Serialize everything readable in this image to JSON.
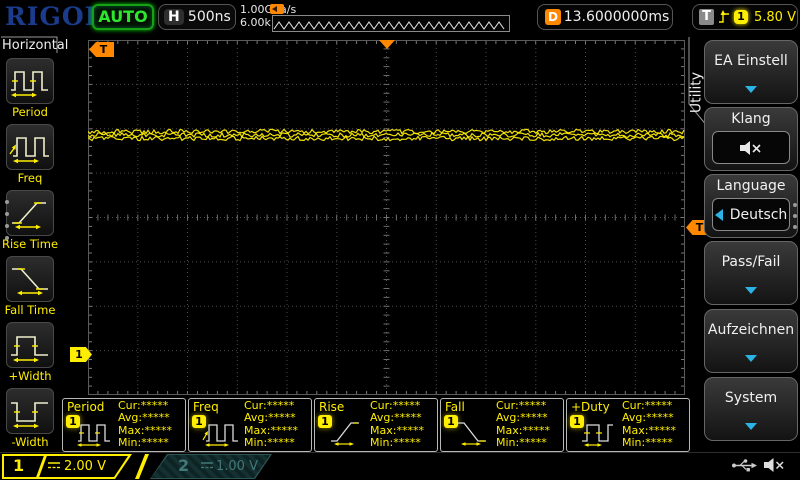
{
  "colors": {
    "trace_yellow": "#ffee00",
    "orange": "#ff8800",
    "menu_blue": "#2bb3e6",
    "run_green": "#2ee62e",
    "logo_blue": "#1b3c8c",
    "ch2_teal": "#437878",
    "grid_gray": "#4c4c4c"
  },
  "top_bar": {
    "logo": "RIGOL",
    "run_status": "AUTO",
    "horizontal_label": "H",
    "timebase": "500ns",
    "sample_rate": "1.00GSa/s",
    "memory_depth": "6.00k pts",
    "delay_label": "D",
    "delay_value": "13.6000000ms",
    "trigger_label": "T",
    "trigger_source": "1",
    "trigger_level": "5.80 V"
  },
  "left_menu": {
    "title": "Horizontal",
    "items": [
      {
        "label": "Period",
        "icon": "period-icon"
      },
      {
        "label": "Freq",
        "icon": "freq-icon"
      },
      {
        "label": "Rise Time",
        "icon": "rise-time-icon"
      },
      {
        "label": "Fall Time",
        "icon": "fall-time-icon"
      },
      {
        "label": "+Width",
        "icon": "plus-width-icon"
      },
      {
        "label": "-Width",
        "icon": "minus-width-icon"
      }
    ]
  },
  "graticule": {
    "trigger_position_label": "T",
    "trigger_level_label": "T",
    "channel_marker": "1"
  },
  "right_menu": {
    "tab": "Utility",
    "items": [
      {
        "label": "EA Einstell",
        "type": "dropdown"
      },
      {
        "label": "Klang",
        "type": "icon-box",
        "icon": "speaker-muted-icon"
      },
      {
        "label": "Language",
        "value": "Deutsch",
        "type": "select"
      },
      {
        "label": "Pass/Fail",
        "type": "dropdown"
      },
      {
        "label": "Aufzeichnen",
        "type": "dropdown"
      },
      {
        "label": "System",
        "type": "dropdown"
      }
    ]
  },
  "measurements": {
    "panels": [
      {
        "name": "Period",
        "channel": "1",
        "stats": [
          {
            "label": "Cur:",
            "value": "*****"
          },
          {
            "label": "Avg:",
            "value": "*****"
          },
          {
            "label": "Max:",
            "value": "*****"
          },
          {
            "label": "Min:",
            "value": "*****"
          }
        ]
      },
      {
        "name": "Freq",
        "channel": "1",
        "stats": [
          {
            "label": "Cur:",
            "value": "*****"
          },
          {
            "label": "Avg:",
            "value": "*****"
          },
          {
            "label": "Max:",
            "value": "*****"
          },
          {
            "label": "Min:",
            "value": "*****"
          }
        ]
      },
      {
        "name": "Rise",
        "channel": "1",
        "stats": [
          {
            "label": "Cur:",
            "value": "*****"
          },
          {
            "label": "Avg:",
            "value": "*****"
          },
          {
            "label": "Max:",
            "value": "*****"
          },
          {
            "label": "Min:",
            "value": "*****"
          }
        ]
      },
      {
        "name": "Fall",
        "channel": "1",
        "stats": [
          {
            "label": "Cur:",
            "value": "*****"
          },
          {
            "label": "Avg:",
            "value": "*****"
          },
          {
            "label": "Max:",
            "value": "*****"
          },
          {
            "label": "Min:",
            "value": "*****"
          }
        ]
      },
      {
        "name": "+Duty",
        "channel": "1",
        "stats": [
          {
            "label": "Cur:",
            "value": "*****"
          },
          {
            "label": "Avg:",
            "value": "*****"
          },
          {
            "label": "Max:",
            "value": "*****"
          },
          {
            "label": "Min:",
            "value": "*****"
          }
        ]
      }
    ]
  },
  "channels": [
    {
      "id": "1",
      "scale": "2.00 V",
      "active": true
    },
    {
      "id": "2",
      "scale": "1.00 V",
      "active": false
    }
  ],
  "status_icons": [
    "usb-icon",
    "speaker-muted-icon"
  ]
}
